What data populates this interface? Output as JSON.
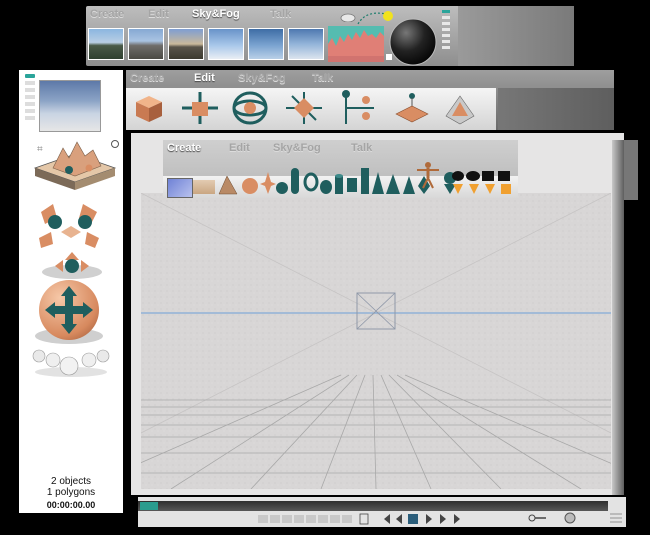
{
  "sky_panel": {
    "tabs": [
      {
        "label": "Create",
        "active": false
      },
      {
        "label": "Edit",
        "active": false
      },
      {
        "label": "Sky&Fog",
        "active": true
      },
      {
        "label": "Talk",
        "active": false
      }
    ],
    "thumbnails": [
      "mountain-lake-sky",
      "rocky-peaks-sky",
      "valley-sunset-sky",
      "blue-horizon-sky",
      "hazy-blue-sky",
      "cloudy-blue-sky"
    ],
    "histogram_label": "color-gradient-graph",
    "cloud_icon": "cloud-icon",
    "sun_icon": "sun-icon",
    "dial_icon": "fog-dial"
  },
  "edit_panel": {
    "tabs": [
      {
        "label": "Create",
        "active": false
      },
      {
        "label": "Edit",
        "active": true
      },
      {
        "label": "Sky&Fog",
        "active": false
      },
      {
        "label": "Talk",
        "active": false
      }
    ],
    "tools": [
      "cube-icon",
      "move-axes-icon",
      "rotate-rings-icon",
      "scale-axes-icon",
      "transform-axis-icon",
      "paint-cube-icon",
      "deform-terrain-icon"
    ]
  },
  "create_panel": {
    "tabs": [
      {
        "label": "Create",
        "active": true
      },
      {
        "label": "Edit",
        "active": false
      },
      {
        "label": "Sky&Fog",
        "active": false
      },
      {
        "label": "Talk",
        "active": false
      }
    ],
    "primitives": [
      "sphere",
      "sphere-small",
      "cone",
      "ellipsoid",
      "cylinder-flat",
      "cylinder",
      "cube",
      "torus",
      "tetrahedron",
      "pyramid",
      "disc"
    ]
  },
  "left_panel": {
    "objects": "2 objects",
    "polygons": "1 polygons",
    "time": "00:00:00.00"
  },
  "colors": {
    "copper": "#d89a74",
    "teal": "#1f5e5e",
    "panel_gray": "#9e9e9e",
    "grid_line": "#a8a8a8",
    "horizon": "#6ea0d8"
  }
}
